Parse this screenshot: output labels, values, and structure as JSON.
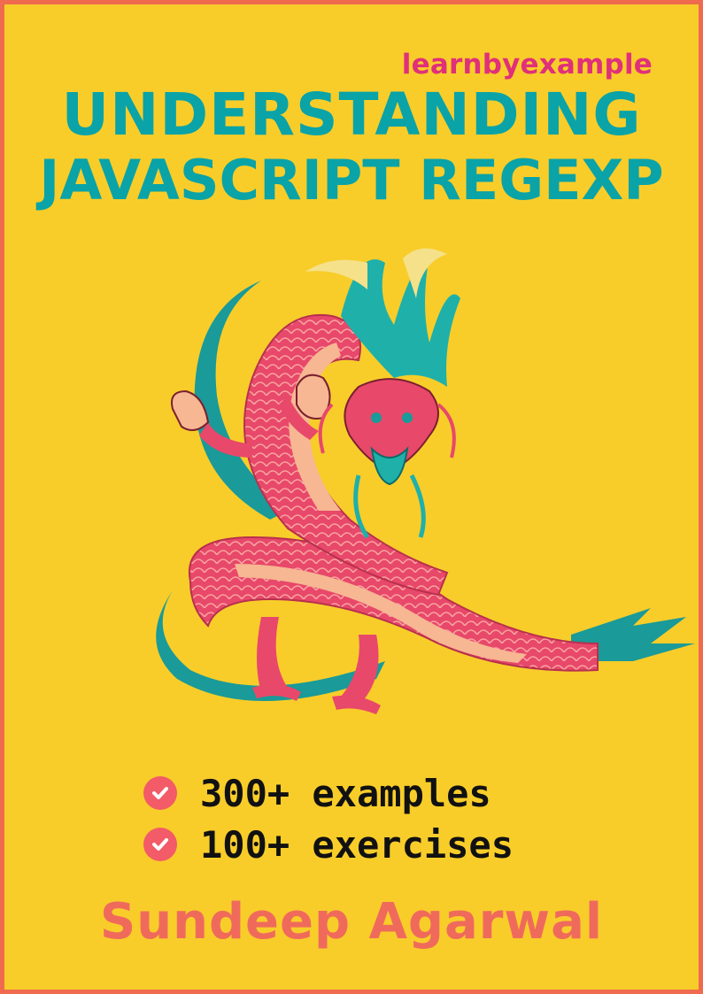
{
  "brand": "learnbyexample",
  "title": {
    "line1": "UNDERSTANDING",
    "line2": "JAVASCRIPT REGEXP"
  },
  "illustration": "dragon",
  "features": [
    {
      "icon": "check-circle-icon",
      "text": "300+ examples"
    },
    {
      "icon": "check-circle-icon",
      "text": "100+ exercises"
    }
  ],
  "author": "Sundeep Agarwal",
  "colors": {
    "border": "#f06a4f",
    "background": "#f8cd2a",
    "title": "#0aa3a7",
    "brand": "#e0307a",
    "author": "#f06a5c",
    "check": "#f25b67"
  }
}
